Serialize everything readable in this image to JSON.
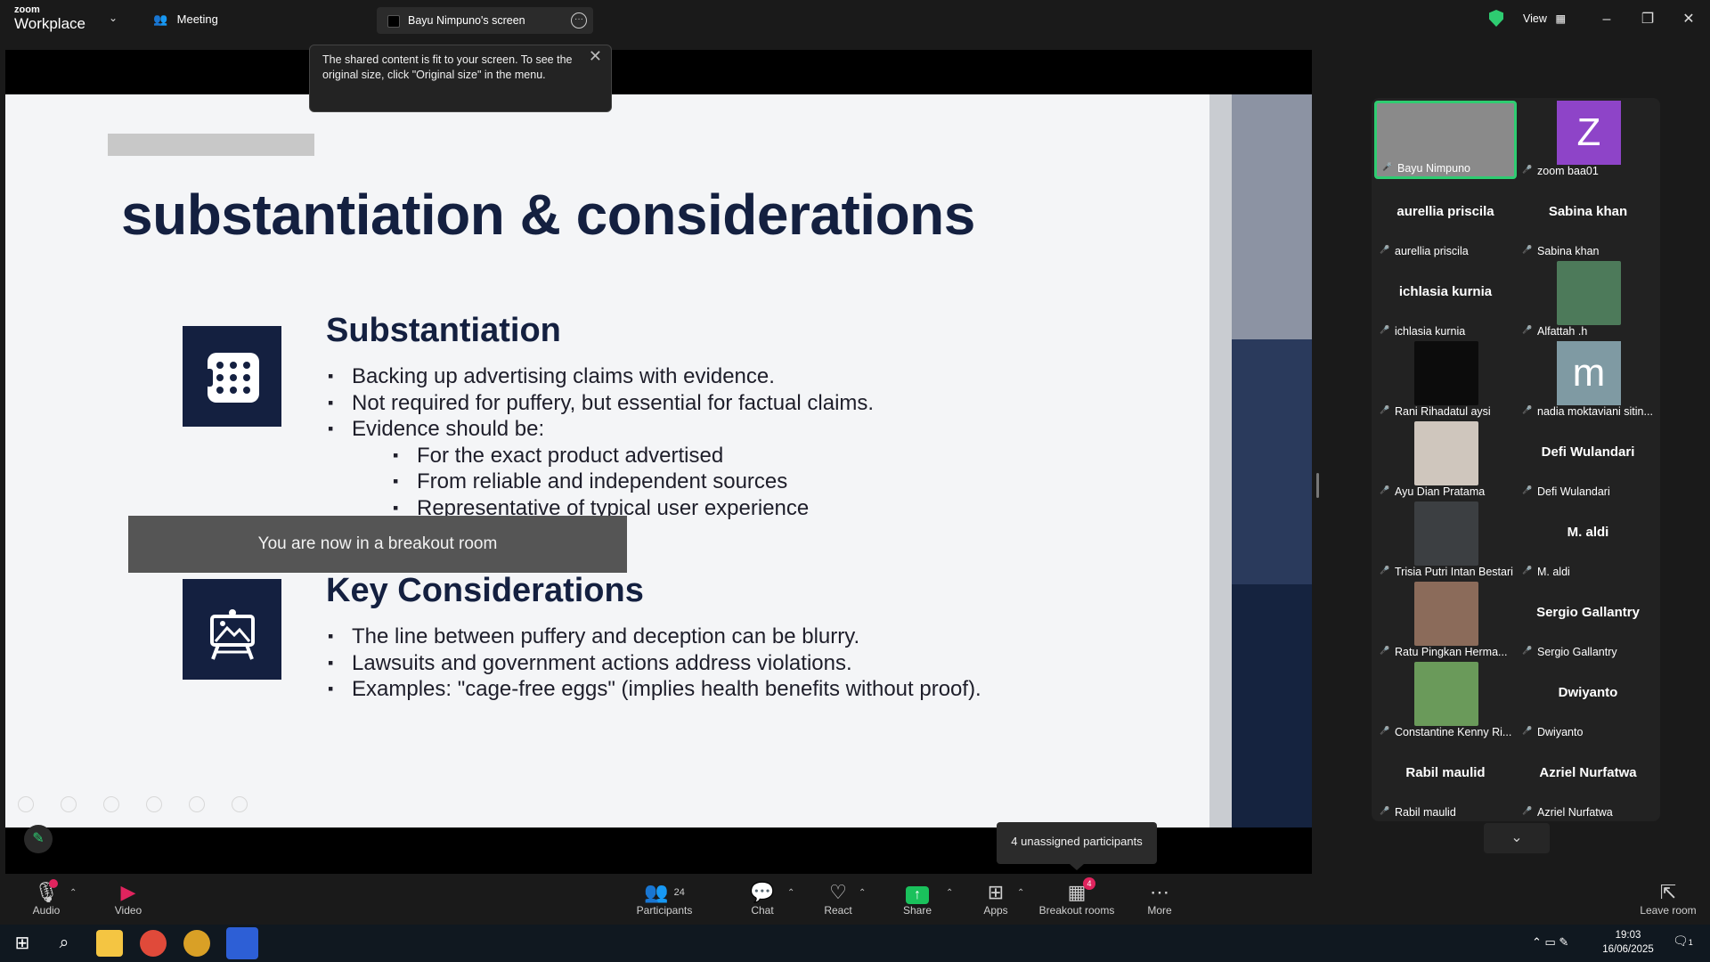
{
  "titlebar": {
    "logo_top": "zoom",
    "logo_bottom": "Workplace",
    "meeting_label": "Meeting",
    "screen_tab": "Bayu Nimpuno's screen",
    "view_label": "View",
    "secure_color": "#2ecc71"
  },
  "notice": {
    "fit_message": "The shared content is fit to your screen. To see the original size, click \"Original size\" in the menu.",
    "breakout_message": "You are now in a breakout room",
    "unassigned": "4 unassigned participants"
  },
  "slide": {
    "title": "substantiation & considerations",
    "section1": {
      "heading": "Substantiation",
      "bullets": [
        "Backing up advertising claims with evidence.",
        "Not required for puffery, but essential for factual claims.",
        "Evidence should be:"
      ],
      "sub_bullets": [
        "For the exact product advertised",
        "From reliable and independent sources",
        "Representative of typical user experience"
      ]
    },
    "section2": {
      "heading": "Key Considerations",
      "bullets": [
        "The line between puffery and deception can be blurry.",
        "Lawsuits and government actions address violations.",
        "Examples: \"cage-free eggs\" (implies health benefits without proof)."
      ]
    }
  },
  "gallery": {
    "tiles": [
      {
        "name": "Bayu Nimpuno",
        "big": "",
        "type": "video",
        "color": "#8a8a8a"
      },
      {
        "name": "zoom baa01",
        "big": "",
        "type": "letter",
        "letter": "Z",
        "color": "#8e44c8"
      },
      {
        "name": "aurellia priscila",
        "big": "aurellia priscila",
        "type": "text"
      },
      {
        "name": "Sabina khan",
        "big": "Sabina khan",
        "type": "text"
      },
      {
        "name": "ichlasia kurnia",
        "big": "ichlasia kurnia",
        "type": "text"
      },
      {
        "name": "Alfattah .h",
        "big": "",
        "type": "photo",
        "color": "#4d7a5a"
      },
      {
        "name": "Rani Rihadatul aysi",
        "big": "",
        "type": "photo",
        "color": "#0c0c0c"
      },
      {
        "name": "nadia moktaviani sitin...",
        "big": "",
        "type": "letter",
        "letter": "m",
        "color": "#7f9aa3"
      },
      {
        "name": "Ayu Dian Pratama",
        "big": "",
        "type": "photo",
        "color": "#cfc6bd"
      },
      {
        "name": "Defi Wulandari",
        "big": "Defi Wulandari",
        "type": "text"
      },
      {
        "name": "Trisia Putri Intan Bestari",
        "big": "",
        "type": "photo",
        "color": "#3c3f42"
      },
      {
        "name": "M. aldi",
        "big": "M. aldi",
        "type": "text"
      },
      {
        "name": "Ratu Pingkan Herma...",
        "big": "",
        "type": "photo",
        "color": "#8b6b5a"
      },
      {
        "name": "Sergio Gallantry",
        "big": "Sergio Gallantry",
        "type": "text"
      },
      {
        "name": "Constantine Kenny Ri...",
        "big": "",
        "type": "photo",
        "color": "#6a9a5a"
      },
      {
        "name": "Dwiyanto",
        "big": "Dwiyanto",
        "type": "text"
      },
      {
        "name": "Rabil maulid",
        "big": "Rabil maulid",
        "type": "text"
      },
      {
        "name": "Azriel Nurfatwa",
        "big": "Azriel Nurfatwa",
        "type": "text"
      }
    ]
  },
  "toolbar": {
    "audio": "Audio",
    "video": "Video",
    "participants": "Participants",
    "participants_count": "24",
    "chat": "Chat",
    "react": "React",
    "share": "Share",
    "apps": "Apps",
    "breakout": "Breakout rooms",
    "breakout_badge": "4",
    "more": "More",
    "leave": "Leave room"
  },
  "taskbar": {
    "time": "19:03",
    "date": "16/06/2025",
    "notif_count": "1"
  }
}
